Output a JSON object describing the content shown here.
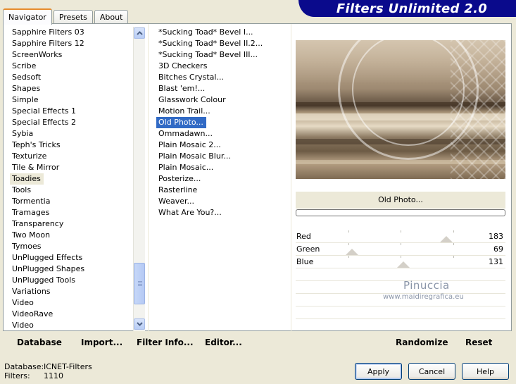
{
  "tabs": [
    {
      "label": "Navigator",
      "active": true
    },
    {
      "label": "Presets",
      "active": false
    },
    {
      "label": "About",
      "active": false
    }
  ],
  "banner": {
    "title": "Filters Unlimited 2.0"
  },
  "categories": {
    "items": [
      "Sapphire Filters 03",
      "Sapphire Filters 12",
      "ScreenWorks",
      "Scribe",
      "Sedsoft",
      "Shapes",
      "Simple",
      "Special Effects 1",
      "Special Effects 2",
      "Sybia",
      "Teph's Tricks",
      "Texturize",
      "Tile & Mirror",
      "Toadies",
      "Tools",
      "Tormentia",
      "Tramages",
      "Transparency",
      "Two Moon",
      "Tymoes",
      "UnPlugged Effects",
      "UnPlugged Shapes",
      "UnPlugged Tools",
      "Variations",
      "Video",
      "VideoRave",
      "Video"
    ],
    "selected": "Toadies"
  },
  "filters": {
    "items": [
      "*Sucking Toad*  Bevel I...",
      "*Sucking Toad*  Bevel II.2...",
      "*Sucking Toad*  Bevel III...",
      "3D Checkers",
      "Bitches Crystal...",
      "Blast 'em!...",
      "Glasswork Colour",
      "Motion Trail...",
      "Old Photo...",
      "Ommadawn...",
      "Plain Mosaic 2...",
      "Plain Mosaic Blur...",
      "Plain Mosaic...",
      "Posterize...",
      "Rasterline",
      "Weaver...",
      "What Are You?..."
    ],
    "selected": "Old Photo..."
  },
  "preview": {
    "filter_name": "Old Photo...",
    "progress": 0
  },
  "sliders": [
    {
      "label": "Red",
      "value": 183,
      "fraction": 0.717
    },
    {
      "label": "Green",
      "value": 69,
      "fraction": 0.27
    },
    {
      "label": "Blue",
      "value": 131,
      "fraction": 0.514
    }
  ],
  "watermark": {
    "name": "Pinuccia",
    "site": "www.maidiregrafica.eu"
  },
  "bottom_buttons": {
    "database": "Database",
    "import": "Import...",
    "filter_info": "Filter Info...",
    "editor": "Editor...",
    "randomize": "Randomize",
    "reset": "Reset"
  },
  "status": {
    "database_label": "Database:",
    "database_value": "ICNET-Filters",
    "filters_label": "Filters:",
    "filters_value": "1110"
  },
  "dialog_buttons": {
    "apply": "Apply",
    "cancel": "Cancel",
    "help": "Help"
  },
  "colors": {
    "banner": "#0A0A8C",
    "selection": "#316AC5",
    "dialog_bg": "#ECE9D8"
  }
}
